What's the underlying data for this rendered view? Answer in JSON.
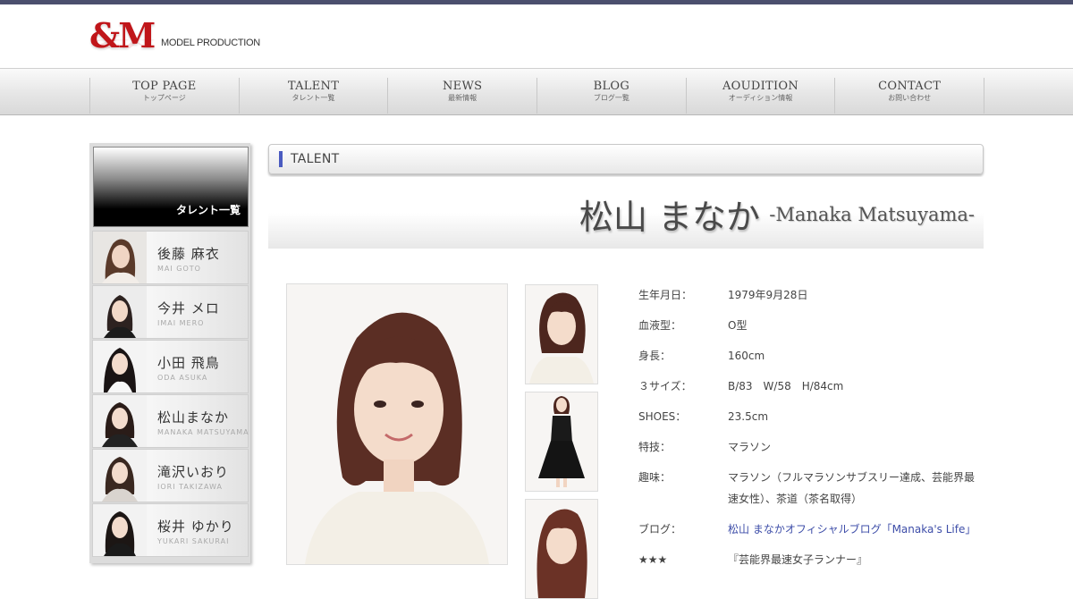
{
  "logo": {
    "mark": "&M",
    "text": "MODEL PRODUCTION"
  },
  "nav": [
    {
      "en": "TOP PAGE",
      "ja": "トップページ"
    },
    {
      "en": "TALENT",
      "ja": "タレント一覧"
    },
    {
      "en": "NEWS",
      "ja": "最新情報"
    },
    {
      "en": "BLOG",
      "ja": "ブログ一覧"
    },
    {
      "en": "AOUDITION",
      "ja": "オーディション情報"
    },
    {
      "en": "CONTACT",
      "ja": "お問い合わせ"
    }
  ],
  "sidebar": {
    "header": "タレント一覧",
    "items": [
      {
        "name": "後藤 麻衣",
        "romaji": "MAI GOTO"
      },
      {
        "name": "今井 メロ",
        "romaji": "IMAI MERO"
      },
      {
        "name": "小田 飛鳥",
        "romaji": "ODA ASUKA"
      },
      {
        "name": "松山まなか",
        "romaji": "MANAKA MATSUYAMA"
      },
      {
        "name": "滝沢いおり",
        "romaji": "IORI TAKIZAWA"
      },
      {
        "name": "桜井 ゆかり",
        "romaji": "YUKARI SAKURAI"
      }
    ]
  },
  "section": {
    "label": "TALENT"
  },
  "talent": {
    "name_ja": "松山 まなか",
    "name_en": "-Manaka Matsuyama-"
  },
  "profile": [
    {
      "key": "生年月日：",
      "value": "1979年9月28日"
    },
    {
      "key": "血液型：",
      "value": "O型"
    },
    {
      "key": "身長：",
      "value": "160cm"
    },
    {
      "key": "３サイズ：",
      "value": "B/83　W/58　H/84cm"
    },
    {
      "key": "SHOES：",
      "value": "23.5cm"
    },
    {
      "key": "特技：",
      "value": "マラソン"
    },
    {
      "key": "趣味：",
      "value": "マラソン（フルマラソンサブスリー達成、芸能界最速女性）、茶道（茶名取得）"
    },
    {
      "key": "ブログ：",
      "value": "松山 まなかオフィシャルブログ「Manaka's Life」"
    },
    {
      "key": "★★★",
      "value": "『芸能界最速女子ランナー』"
    }
  ],
  "colors": {
    "topbar": "#4b4f6e",
    "logo": "#c0161a",
    "accent": "#4a5bc0",
    "link": "#3d4da8"
  }
}
